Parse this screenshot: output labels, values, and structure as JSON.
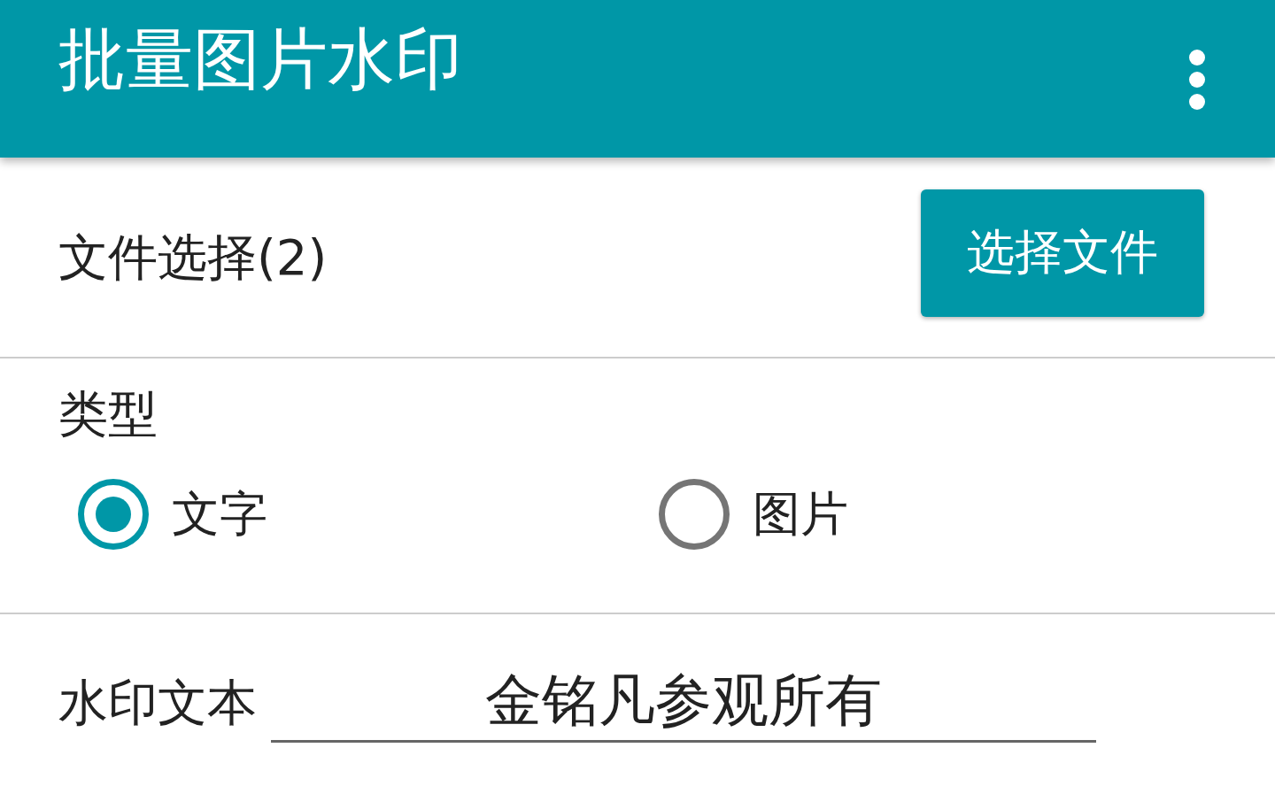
{
  "app_bar": {
    "title": "批量图片水印"
  },
  "file_select": {
    "label": "文件选择(2)",
    "button": "选择文件"
  },
  "type": {
    "label": "类型",
    "options": [
      {
        "label": "文字",
        "selected": true
      },
      {
        "label": "图片",
        "selected": false
      }
    ]
  },
  "watermark_text": {
    "label": "水印文本",
    "value": "金铭凡参观所有"
  }
}
